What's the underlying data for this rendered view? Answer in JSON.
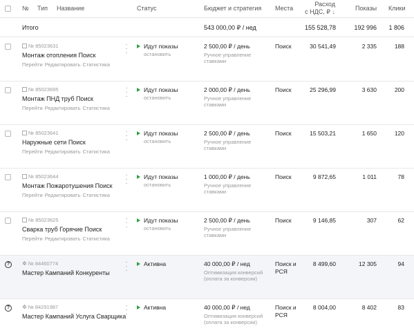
{
  "header": {
    "number": "№",
    "type": "Тип",
    "name": "Название",
    "status": "Статус",
    "budget": "Бюджет и стратегия",
    "places": "Места",
    "expense_line1": "Расход",
    "expense_line2": "с НДС, ₽",
    "sort_icon": "arrow-down-icon",
    "impressions": "Показы",
    "clicks": "Клики"
  },
  "total": {
    "label": "Итого",
    "budget": "543 000,00 ₽ / нед",
    "expense": "155 528,78",
    "impressions": "192 996",
    "clicks": "1 806"
  },
  "campaigns": [
    {
      "id": "№ 85023631",
      "name": "Монтаж отопления Поиск",
      "links": [
        "Перейти",
        "Редактировать",
        "Статистика"
      ],
      "status": "Идут показы",
      "stop": "остановить",
      "budget": "2 500,00 ₽ / день",
      "strategy": "Ручное управление ставками",
      "places": "Поиск",
      "expense": "30 541,49",
      "impressions": "2 335",
      "clicks": "188"
    },
    {
      "id": "№ 85023695",
      "name": "Монтаж ПНД труб Поиск",
      "links": [
        "Перейти",
        "Редактировать",
        "Статистика"
      ],
      "status": "Идут показы",
      "stop": "остановить",
      "budget": "2 000,00 ₽ / день",
      "strategy": "Ручное управление ставками",
      "places": "Поиск",
      "expense": "25 296,99",
      "impressions": "3 630",
      "clicks": "200"
    },
    {
      "id": "№ 85023641",
      "name": "Наружные сети Поиск",
      "links": [
        "Перейти",
        "Редактировать",
        "Статистика"
      ],
      "status": "Идут показы",
      "stop": "остановить",
      "budget": "2 500,00 ₽ / день",
      "strategy": "Ручное управление ставками",
      "places": "Поиск",
      "expense": "15 503,21",
      "impressions": "1 650",
      "clicks": "120"
    },
    {
      "id": "№ 85023644",
      "name": "Монтаж Пожаротушения Поиск",
      "links": [
        "Перейти",
        "Редактировать",
        "Статистика"
      ],
      "status": "Идут показы",
      "stop": "остановить",
      "budget": "1 000,00 ₽ / день",
      "strategy": "Ручное управление ставками",
      "places": "Поиск",
      "expense": "9 872,65",
      "impressions": "1 011",
      "clicks": "78"
    },
    {
      "id": "№ 85023625",
      "name": "Сварка труб Горячие Поиск",
      "links": [
        "Перейти",
        "Редактировать",
        "Статистика"
      ],
      "status": "Идут показы",
      "stop": "остановить",
      "budget": "2 500,00 ₽ / день",
      "strategy": "Ручное управление ставками",
      "places": "Поиск",
      "expense": "9 146,85",
      "impressions": "307",
      "clicks": "62"
    },
    {
      "id": "№ 84460774",
      "name": "Мастер Кампаний Конкуренты",
      "links": [],
      "status": "Активна",
      "stop": "",
      "budget": "40 000,00 ₽ / нед",
      "strategy": "Оптимизация конверсий (оплата за конверсии)",
      "places": "Поиск и РСЯ",
      "expense": "8 499,60",
      "impressions": "12 305",
      "clicks": "94"
    },
    {
      "id": "№ 84291987",
      "name": "Мастер Кампаний Услуга Сварщика",
      "links": [],
      "status": "Активна",
      "stop": "",
      "budget": "40 000,00 ₽ / нед",
      "strategy": "Оптимизация конверсий (оплата за конверсии)",
      "places": "Поиск и РСЯ",
      "expense": "8 004,00",
      "impressions": "8 402",
      "clicks": "83"
    }
  ]
}
